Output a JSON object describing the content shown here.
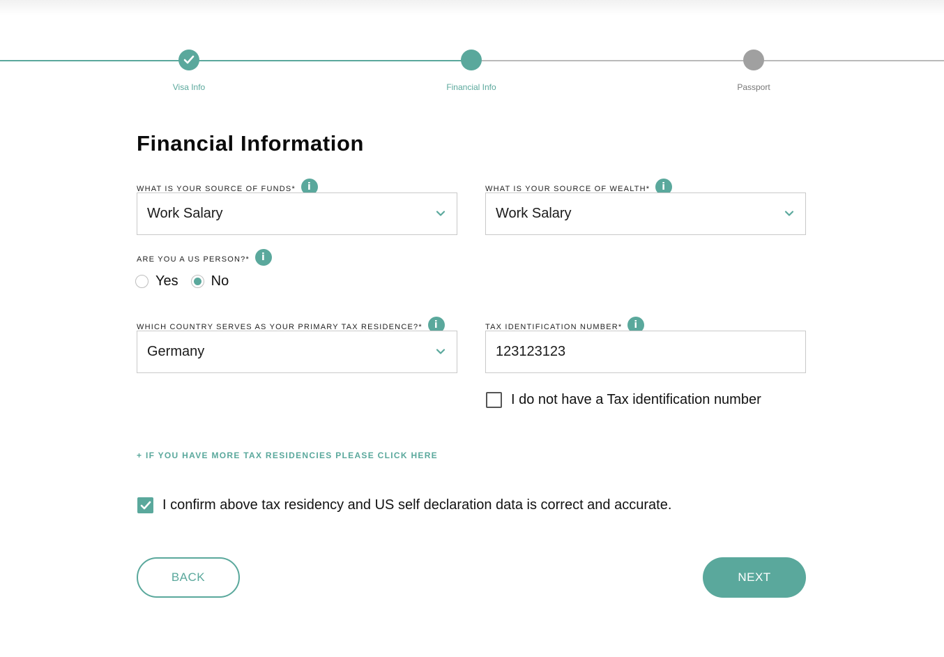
{
  "colors": {
    "accent": "#5aa89c",
    "inactive": "#a0a0a0"
  },
  "stepper": {
    "steps": [
      {
        "label": "Visa Info",
        "status": "completed",
        "icon": "check-icon"
      },
      {
        "label": "Financial Info",
        "status": "active"
      },
      {
        "label": "Passport",
        "status": "pending"
      }
    ]
  },
  "form": {
    "title": "Financial Information",
    "source_of_funds": {
      "label": "WHAT IS YOUR SOURCE OF FUNDS*",
      "value": "Work Salary"
    },
    "source_of_wealth": {
      "label": "WHAT IS YOUR SOURCE OF WEALTH*",
      "value": "Work Salary"
    },
    "us_person": {
      "label": "ARE YOU A US PERSON?*",
      "options": [
        "Yes",
        "No"
      ],
      "selected": "No"
    },
    "tax_residence": {
      "label": "WHICH COUNTRY SERVES AS YOUR PRIMARY TAX RESIDENCE?*",
      "value": "Germany"
    },
    "tin": {
      "label": "TAX IDENTIFICATION NUMBER*",
      "value": "123123123"
    },
    "no_tin": {
      "label": "I do not have a Tax identification number",
      "checked": false
    },
    "more_residencies_link": "+ IF YOU HAVE MORE TAX RESIDENCIES PLEASE CLICK HERE",
    "confirm": {
      "label": "I confirm above tax residency and US self declaration data is correct and accurate.",
      "checked": true
    },
    "back_label": "BACK",
    "next_label": "NEXT"
  }
}
